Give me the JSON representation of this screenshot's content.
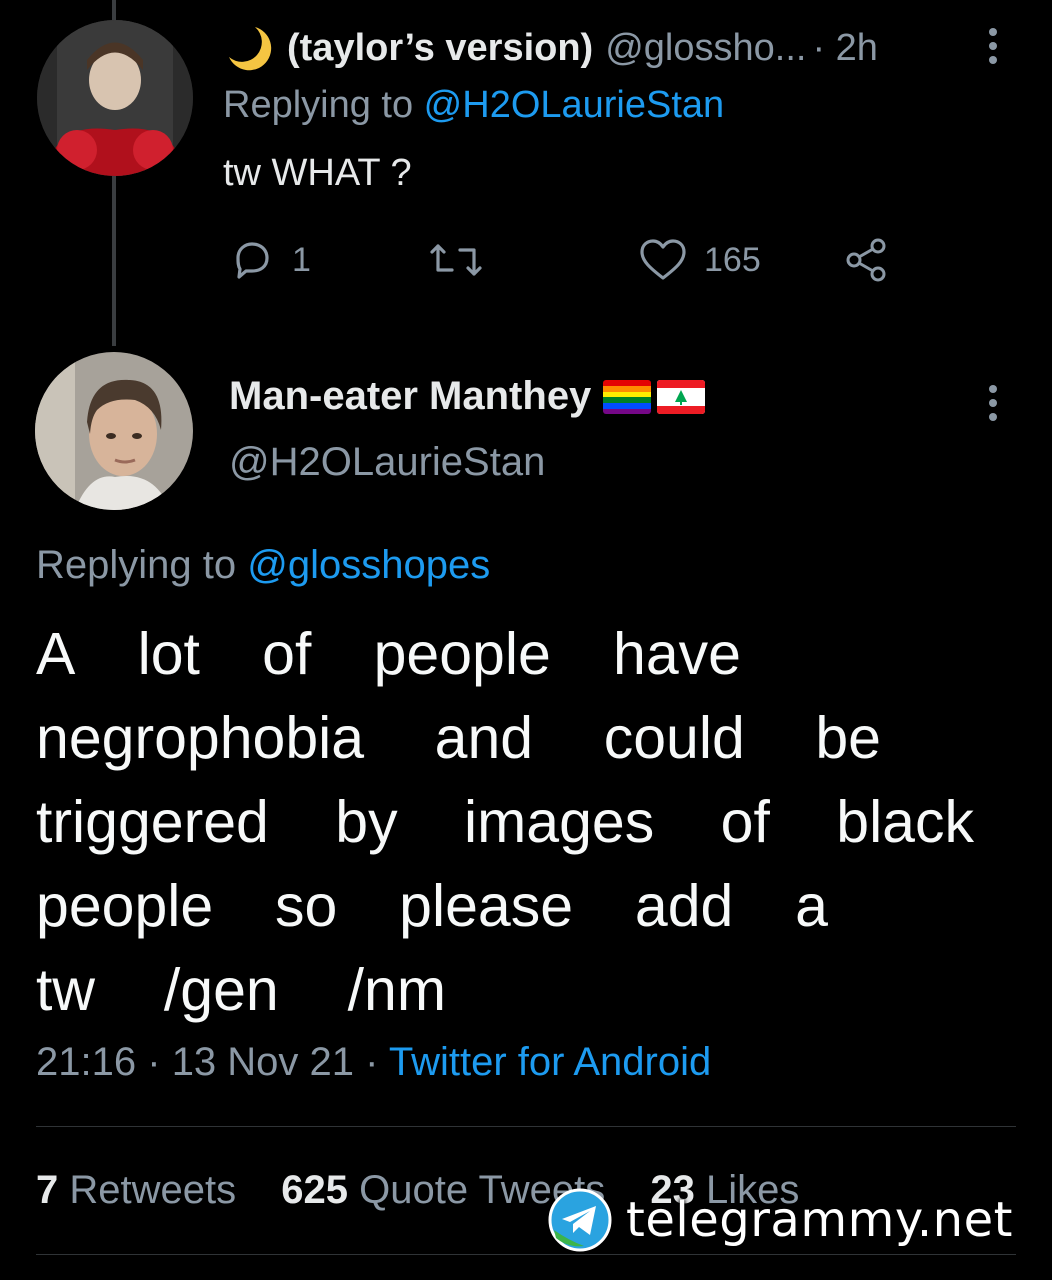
{
  "reply_tweet": {
    "emoji_icon": "crescent-moon-icon",
    "name": "(taylor’s version)",
    "handle": "@glossho...",
    "time": "· 2h",
    "replying_prefix": "Replying to ",
    "replying_to": "@H2OLaurieStan",
    "text": "tw WHAT ?",
    "reply_count": "1",
    "retweet_count": "",
    "like_count": "165"
  },
  "main_tweet": {
    "name": "Man-eater Manthey",
    "flags": [
      "rainbow-flag-icon",
      "lebanon-flag-icon"
    ],
    "handle": "@H2OLaurieStan",
    "replying_prefix": "Replying to ",
    "replying_to": "@glosshopes",
    "body_lines": [
      [
        "A",
        "lot",
        "of",
        "people",
        "have"
      ],
      [
        "negrophobia",
        "and",
        "could",
        "be"
      ],
      [
        "triggered",
        "by",
        "images",
        "of",
        "black"
      ],
      [
        "people",
        "so",
        "please",
        "add",
        "a"
      ],
      [
        "tw",
        "/gen",
        "/nm"
      ]
    ],
    "time": "21:16",
    "separator": "·",
    "date": "13 Nov 21",
    "source": "Twitter for Android"
  },
  "stats": {
    "retweets_count": "7",
    "retweets_label": "Retweets",
    "quotes_count": "625",
    "quotes_label": "Quote Tweets",
    "likes_count": "23",
    "likes_label": "Likes"
  },
  "watermark": {
    "text": "telegrammy.net"
  },
  "colors": {
    "background": "#000000",
    "text_primary": "#e7e9ea",
    "text_secondary": "#8b98a5",
    "link": "#1d9bf0",
    "divider": "#2f3336"
  }
}
